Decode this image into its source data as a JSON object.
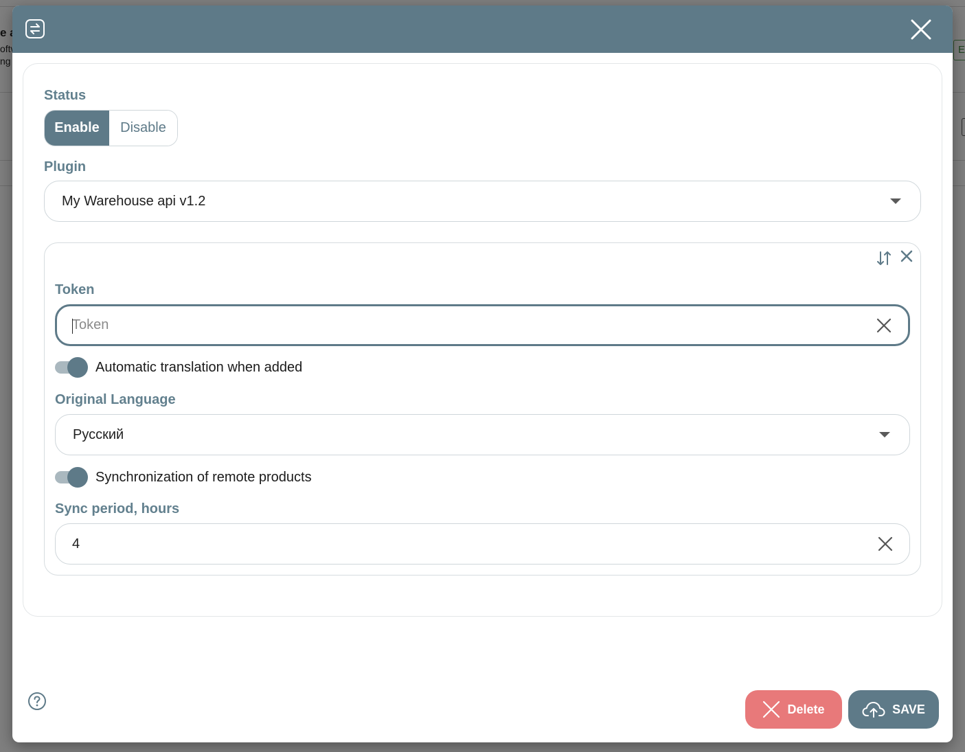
{
  "background": {
    "fragments": [
      "e a",
      "oftw",
      "ng g"
    ],
    "button_fragment": "E"
  },
  "dialog": {
    "status": {
      "label": "Status",
      "options": [
        "Enable",
        "Disable"
      ],
      "selected": "Enable"
    },
    "plugin": {
      "label": "Plugin",
      "value": "My Warehouse api v1.2"
    },
    "settings": {
      "token": {
        "label": "Token",
        "value": "",
        "placeholder": "Token"
      },
      "auto_translation": {
        "label": "Automatic translation when added",
        "enabled": true
      },
      "original_language": {
        "label": "Original Language",
        "value": "Русский"
      },
      "sync_remote": {
        "label": "Synchronization of remote products",
        "enabled": true
      },
      "sync_period": {
        "label": "Sync period, hours",
        "value": "4"
      }
    },
    "footer": {
      "delete_label": "Delete",
      "save_label": "SAVE"
    }
  },
  "colors": {
    "header": "#5e7a88",
    "label": "#62808e",
    "delete": "#e8797a",
    "save": "#5e7a88"
  },
  "icons": [
    "swap-icon",
    "close-icon",
    "chevron-down-icon",
    "sort-icon",
    "clear-icon",
    "help-icon",
    "cloud-upload-icon"
  ]
}
